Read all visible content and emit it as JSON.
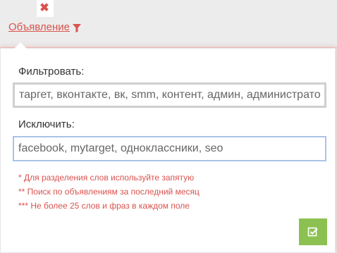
{
  "header": {
    "close_icon": "close-icon",
    "filter_link_label": "Объявление",
    "filter_icon": "funnel-icon"
  },
  "popover": {
    "include_label": "Фильтровать:",
    "include_value": "таргет, вконтакте, вк, smm, контент, админ, администратор",
    "exclude_label": "Исключить:",
    "exclude_value": "facebook, mytarget, одноклассники, seo",
    "hints": [
      "* Для разделения слов используйте запятую",
      "** Поиск по объявлениям за последний месяц",
      "*** Не более 25 слов и фраз в каждом поле"
    ],
    "apply_icon": "check-square-icon"
  },
  "colors": {
    "accent_red": "#d9534f",
    "apply_green": "#8cc152",
    "focus_border": "#a9c3e8"
  }
}
